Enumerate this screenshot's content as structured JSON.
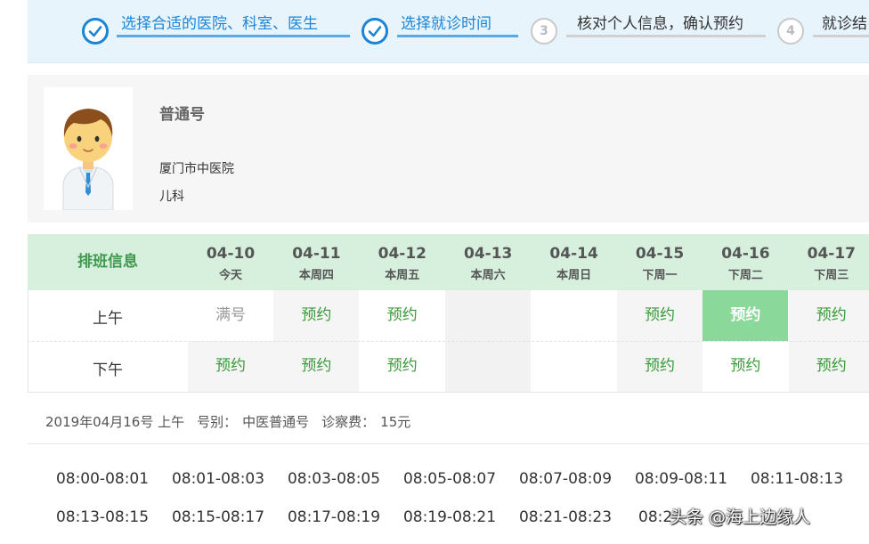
{
  "steps": [
    {
      "label": "选择合适的医院、科室、医生",
      "state": "done"
    },
    {
      "label": "选择就诊时间",
      "state": "done"
    },
    {
      "label": "核对个人信息，确认预约",
      "number": "3",
      "state": "todo"
    },
    {
      "label": "就诊结",
      "number": "4",
      "state": "todo"
    }
  ],
  "doctor": {
    "type": "普通号",
    "hospital": "厦门市中医院",
    "department": "儿科"
  },
  "schedule": {
    "title": "排班信息",
    "days": [
      {
        "date": "04-10",
        "week": "今天"
      },
      {
        "date": "04-11",
        "week": "本周四"
      },
      {
        "date": "04-12",
        "week": "本周五"
      },
      {
        "date": "04-13",
        "week": "本周六"
      },
      {
        "date": "04-14",
        "week": "本周日"
      },
      {
        "date": "04-15",
        "week": "下周一"
      },
      {
        "date": "04-16",
        "week": "下周二"
      },
      {
        "date": "04-17",
        "week": "下周三"
      }
    ],
    "rows": [
      {
        "label": "上午",
        "cells": [
          {
            "text": "满号",
            "status": "full"
          },
          {
            "text": "预约",
            "status": "book"
          },
          {
            "text": "预约",
            "status": "book"
          },
          {
            "text": "",
            "status": "empty"
          },
          {
            "text": "",
            "status": "empty"
          },
          {
            "text": "预约",
            "status": "book"
          },
          {
            "text": "预约",
            "status": "selected"
          },
          {
            "text": "预约",
            "status": "book"
          }
        ]
      },
      {
        "label": "下午",
        "cells": [
          {
            "text": "预约",
            "status": "book"
          },
          {
            "text": "预约",
            "status": "book"
          },
          {
            "text": "预约",
            "status": "book"
          },
          {
            "text": "",
            "status": "empty"
          },
          {
            "text": "",
            "status": "empty"
          },
          {
            "text": "预约",
            "status": "book"
          },
          {
            "text": "预约",
            "status": "book"
          },
          {
            "text": "预约",
            "status": "book"
          }
        ]
      }
    ]
  },
  "selection": {
    "date_session": "2019年04月16号 上午",
    "type_label": "号别：",
    "type_value": "中医普通号",
    "fee_label": "诊察费：",
    "fee_value": "15元"
  },
  "time_slots": [
    [
      "08:00-08:01",
      "08:01-08:03",
      "08:03-08:05",
      "08:05-08:07",
      "08:07-08:09",
      "08:09-08:11",
      "08:11-08:13"
    ],
    [
      "08:13-08:15",
      "08:15-08:17",
      "08:17-08:19",
      "08:19-08:21",
      "08:21-08:23",
      "08:2",
      ""
    ]
  ],
  "watermark": "头条 @海上边缘人",
  "colors": {
    "accent_blue": "#1a84d6",
    "header_green": "#d7f0de",
    "book_green": "#3a9a3a",
    "selected_green": "#8ad99a"
  }
}
